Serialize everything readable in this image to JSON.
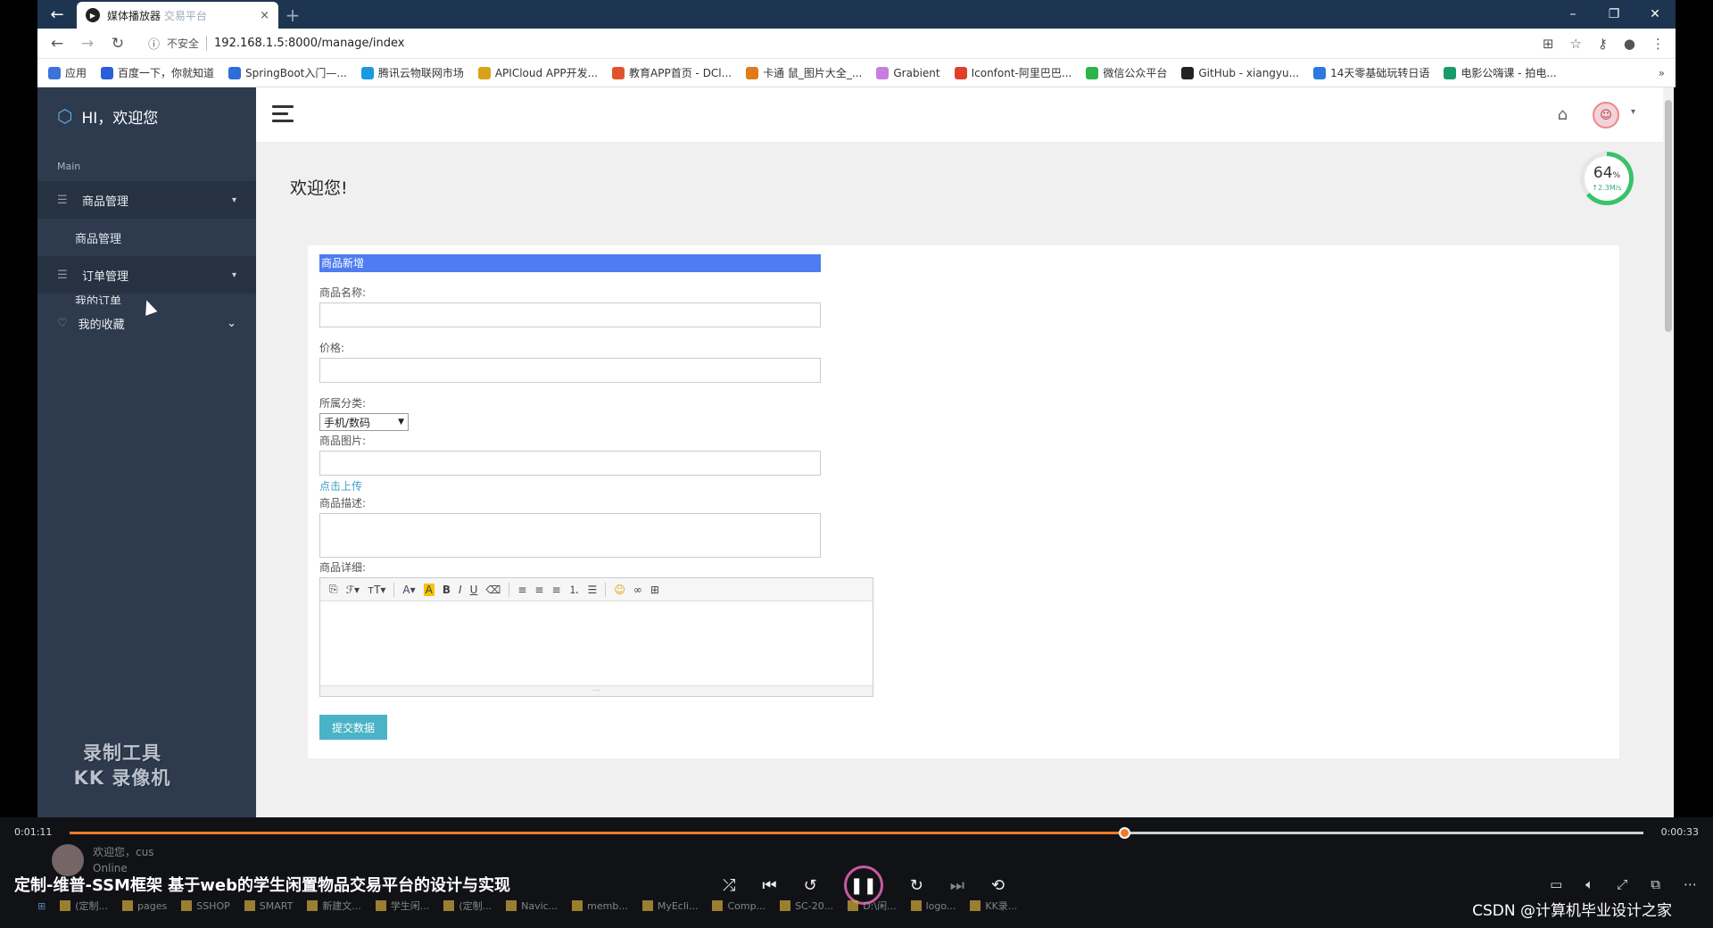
{
  "browser": {
    "tab_title": "媒体播放器",
    "tab_subtitle": "交易平台",
    "tab_close": "×",
    "new_tab": "+",
    "insecure_label": "不安全",
    "url": "192.168.1.5:8000/manage/index",
    "bookmarks": [
      {
        "label": "应用",
        "color": "#3b73d9"
      },
      {
        "label": "百度一下，你就知道",
        "color": "#2b5fd9"
      },
      {
        "label": "SpringBoot入门—...",
        "color": "#2b6ed9"
      },
      {
        "label": "腾讯云物联网市场",
        "color": "#1a9ae0"
      },
      {
        "label": "APICloud APP开发...",
        "color": "#d9a21a"
      },
      {
        "label": "教育APP首页 - DCl...",
        "color": "#e0532a"
      },
      {
        "label": "卡通 鼠_图片大全_...",
        "color": "#e07a1a"
      },
      {
        "label": "Grabient",
        "color": "#c77ee0"
      },
      {
        "label": "Iconfont-阿里巴巴...",
        "color": "#e0402a"
      },
      {
        "label": "微信公众平台",
        "color": "#2ab54a"
      },
      {
        "label": "GitHub - xiangyu...",
        "color": "#222222"
      },
      {
        "label": "14天零基础玩转日语",
        "color": "#2a7ae0"
      },
      {
        "label": "电影公嗨课 - 拍电...",
        "color": "#1a9a6a"
      }
    ],
    "bookmarks_more": "»"
  },
  "sidebar": {
    "brand": "HI，欢迎您",
    "section": "Main",
    "menus": [
      {
        "label": "商品管理",
        "arrow": "▾",
        "sub": "商品管理"
      },
      {
        "label": "订单管理",
        "arrow": "▾",
        "sub": "我的订单"
      },
      {
        "label": "我的收藏",
        "arrow": "⌄"
      }
    ],
    "watermark_line1": "录制工具",
    "watermark_line2": "KK 录像机"
  },
  "page": {
    "welcome": "欢迎您!",
    "gauge_value": "64",
    "gauge_unit": "%",
    "gauge_speed": "↑2.3M/s",
    "gauge_fraction": 0.64
  },
  "form": {
    "title": "商品新增",
    "name_label": "商品名称:",
    "price_label": "价格:",
    "category_label": "所属分类:",
    "category_selected": "手机/数码",
    "image_label": "商品图片:",
    "upload_link": "点击上传",
    "desc_label": "商品描述:",
    "detail_label": "商品详细:",
    "submit": "提交数据"
  },
  "player": {
    "time_elapsed": "0:01:11",
    "time_remaining": "0:00:33",
    "progress_fraction": 0.67,
    "caption": "定制-维普-SSM框架 基于web的学生闲置物品交易平台的设计与实现",
    "user_greeting": "欢迎您，cus",
    "user_status": "Online"
  },
  "taskbar": [
    "(定制...",
    "pages",
    "SSHOP",
    "SMART",
    "新建文...",
    "学生闲...",
    "(定制...",
    "Navic...",
    "memb...",
    "MyEcli...",
    "Comp...",
    "SC-20...",
    "D:\\闲...",
    "logo...",
    "KK录..."
  ],
  "watermark_site": "CSDN @计算机毕业设计之家"
}
